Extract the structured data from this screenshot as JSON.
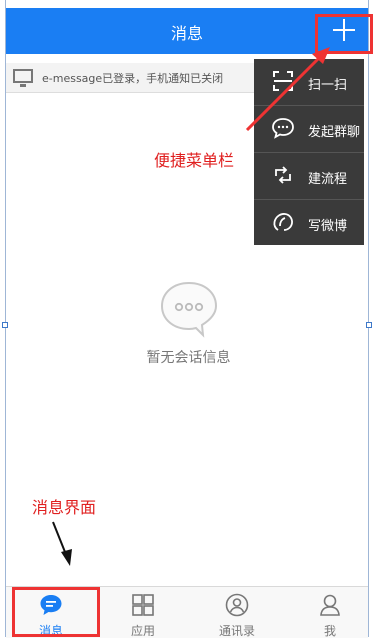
{
  "header": {
    "title": "消息"
  },
  "notice": {
    "text": "e-message已登录，手机通知已关闭"
  },
  "menu": {
    "items": [
      {
        "label": "扫一扫",
        "icon": "scan-icon"
      },
      {
        "label": "发起群聊",
        "icon": "group-chat-icon"
      },
      {
        "label": "建流程",
        "icon": "workflow-icon"
      },
      {
        "label": "写微博",
        "icon": "weibo-icon"
      }
    ]
  },
  "empty_state": {
    "text": "暂无会话信息",
    "icon": "chat-bubble-icon"
  },
  "annotations": {
    "menu_label": "便捷菜单栏",
    "messages_label": "消息界面"
  },
  "tabs": [
    {
      "label": "消息",
      "icon": "message-icon",
      "active": true
    },
    {
      "label": "应用",
      "icon": "apps-grid-icon",
      "active": false
    },
    {
      "label": "通讯录",
      "icon": "contacts-icon",
      "active": false
    },
    {
      "label": "我",
      "icon": "profile-icon",
      "active": false
    }
  ],
  "colors": {
    "brand": "#1a7ef3",
    "menu_bg": "#3a3a3a",
    "annotation": "#e02020"
  }
}
